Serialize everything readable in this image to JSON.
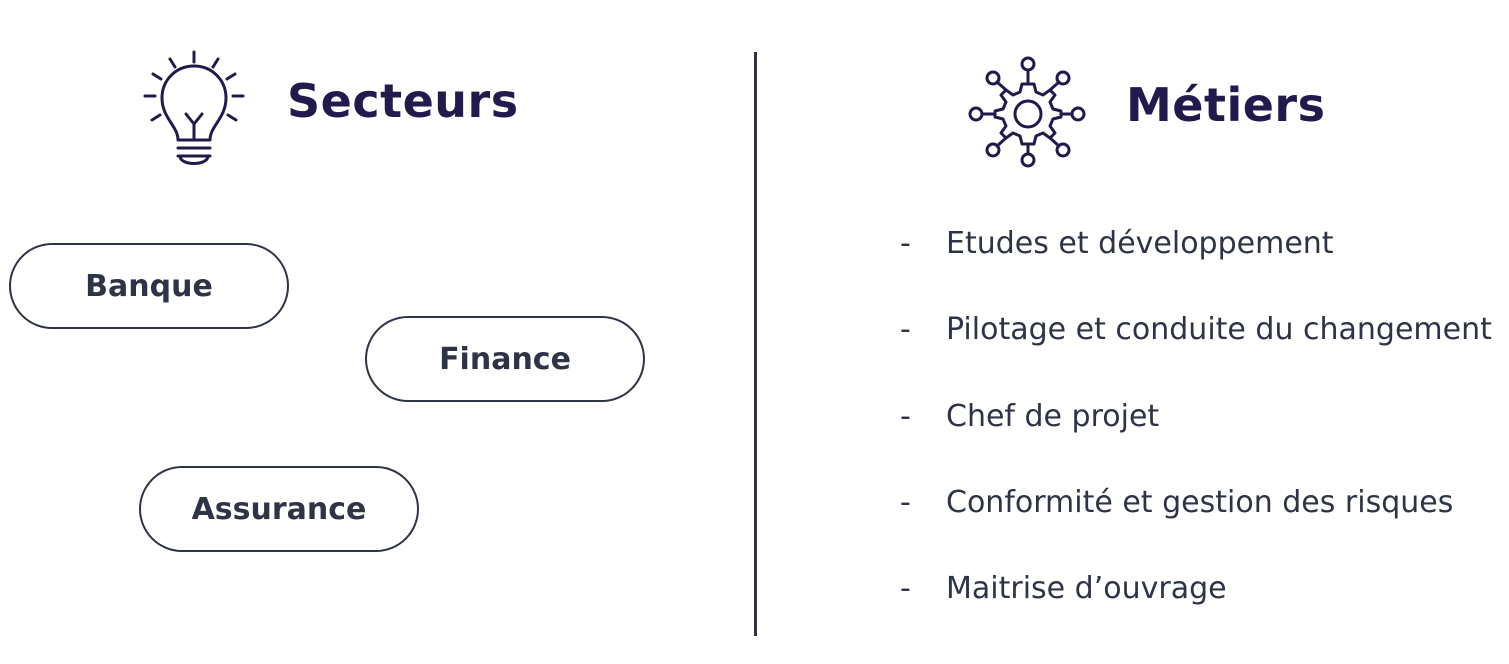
{
  "secteurs": {
    "title": "Secteurs",
    "icon": "lightbulb-icon",
    "items": [
      {
        "label": "Banque"
      },
      {
        "label": "Finance"
      },
      {
        "label": "Assurance"
      }
    ]
  },
  "metiers": {
    "title": "Métiers",
    "icon": "gear-network-icon",
    "bullet": "-",
    "items": [
      {
        "label": "Etudes et développement"
      },
      {
        "label": "Pilotage et conduite du changement"
      },
      {
        "label": "Chef de projet"
      },
      {
        "label": "Conformité et gestion des risques"
      },
      {
        "label": "Maitrise d’ouvrage"
      }
    ]
  },
  "colors": {
    "heading": "#221a4d",
    "text": "#2e3446",
    "background": "#ffffff"
  }
}
